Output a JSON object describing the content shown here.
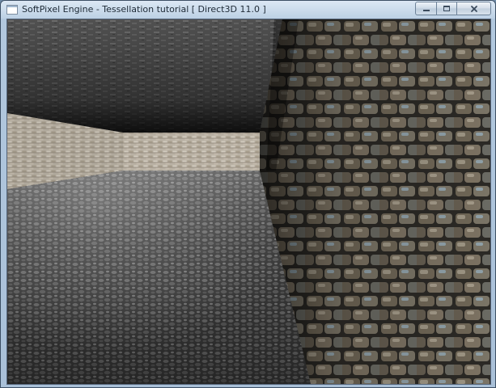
{
  "window": {
    "title": "SoftPixel Engine - Tessellation tutorial [ Direct3D 11.0 ]",
    "app_icon": "blank-window-icon",
    "controls": {
      "minimize_icon": "minimize-icon",
      "maximize_icon": "maximize-icon",
      "close_icon": "close-icon"
    }
  },
  "viewport": {
    "scene": "tessellated-stone-corridor"
  },
  "colors": {
    "title_bar_top": "#dce8f4",
    "title_bar_bottom": "#bcd0e4",
    "frame": "#b2c8de",
    "title_text": "#1e2a36"
  }
}
